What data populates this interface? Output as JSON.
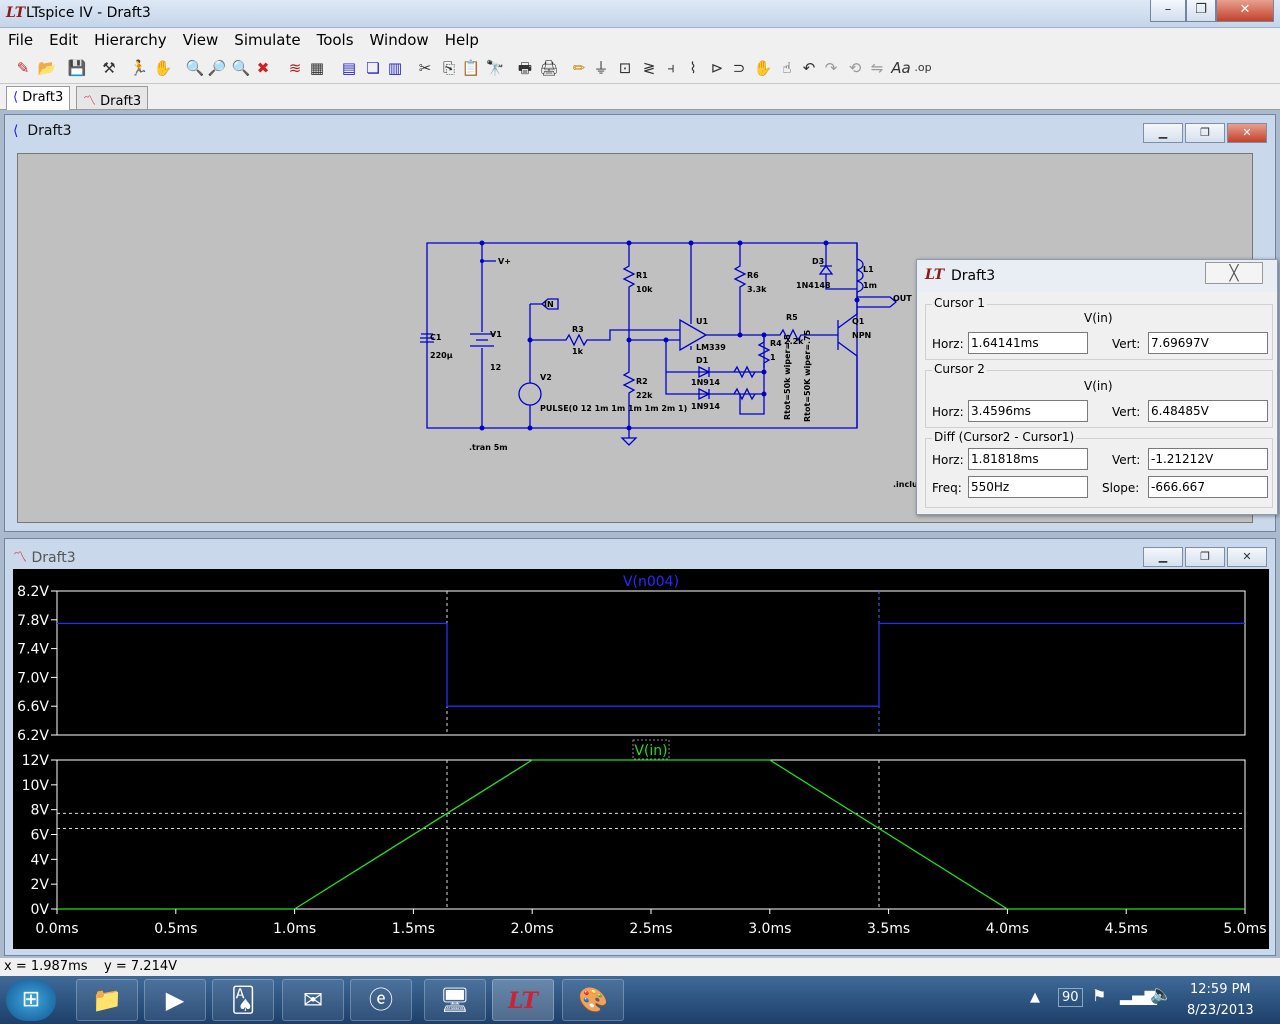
{
  "app": {
    "title": "LTspice IV - Draft3",
    "logo_text": "LT"
  },
  "menu": [
    "File",
    "Edit",
    "Hierarchy",
    "View",
    "Simulate",
    "Tools",
    "Window",
    "Help"
  ],
  "tabs": [
    {
      "label": "Draft3"
    },
    {
      "label": "Draft3"
    }
  ],
  "schematic_window": {
    "title": "Draft3",
    "labels": {
      "vplus": "V+",
      "in": "IN",
      "out": "OUT",
      "r1": "R1",
      "r1v": "10k",
      "r2": "R2",
      "r2v": "22k",
      "r3": "R3",
      "r3v": "1k",
      "r4": "R4",
      "r4v": "1",
      "r5": "R5",
      "r5v": "2.2k",
      "r6": "R6",
      "r6v": "3.3k",
      "u1": "U1",
      "u1v": "LM339",
      "c1": "C1",
      "c1v": "220µ",
      "v1": "V1",
      "v1v": "12",
      "v2": "V2",
      "v2v": "PULSE(0 12 1m 1m 1m 1m 2m 1)",
      "d1": "D1",
      "d1v": "1N914",
      "d2v": "1N914",
      "d3": "D3",
      "d3v": "1N4148",
      "l1": "L1",
      "l1v": "1m",
      "q1": "Q1",
      "q1v": "NPN",
      "pot1": "Rtot=50k wiper=.5",
      "pot2": "Rtot=50K wiper=.75",
      "tran": ".tran 5m",
      "include": ".include"
    }
  },
  "cursor_window": {
    "title": "Draft3",
    "cursor1": {
      "label": "Cursor 1",
      "trace": "V(in)",
      "horz_label": "Horz:",
      "horz": "1.64141ms",
      "vert_label": "Vert:",
      "vert": "7.69697V"
    },
    "cursor2": {
      "label": "Cursor 2",
      "trace": "V(in)",
      "horz_label": "Horz:",
      "horz": "3.4596ms",
      "vert_label": "Vert:",
      "vert": "6.48485V"
    },
    "diff": {
      "label": "Diff (Cursor2 - Cursor1)",
      "horz_label": "Horz:",
      "horz": "1.81818ms",
      "vert_label": "Vert:",
      "vert": "-1.21212V",
      "freq_label": "Freq:",
      "freq": "550Hz",
      "slope_label": "Slope:",
      "slope": "-666.667"
    }
  },
  "waveform_window": {
    "title": "Draft3"
  },
  "chart_data": [
    {
      "type": "line",
      "title": "V(n004)",
      "ylim": [
        6.2,
        8.2
      ],
      "yticks": [
        "8.2V",
        "7.8V",
        "7.4V",
        "7.0V",
        "6.6V",
        "6.2V"
      ],
      "ytick_values": [
        8.2,
        7.8,
        7.4,
        7.0,
        6.6,
        6.2
      ],
      "series": [
        {
          "name": "V(n004)",
          "color": "#2a2aff",
          "x": [
            0,
            1.64141,
            1.64141,
            3.4596,
            3.4596,
            5
          ],
          "y": [
            7.75,
            7.75,
            6.6,
            6.6,
            7.75,
            7.75
          ]
        }
      ],
      "cursors_x": [
        1.64141,
        3.4596
      ],
      "xlim": [
        0,
        5
      ]
    },
    {
      "type": "line",
      "title": "V(in)",
      "ylim": [
        0,
        12
      ],
      "yticks": [
        "12V",
        "10V",
        "8V",
        "6V",
        "4V",
        "2V",
        "0V"
      ],
      "ytick_values": [
        12,
        10,
        8,
        6,
        4,
        2,
        0
      ],
      "xticks": [
        "0.0ms",
        "0.5ms",
        "1.0ms",
        "1.5ms",
        "2.0ms",
        "2.5ms",
        "3.0ms",
        "3.5ms",
        "4.0ms",
        "4.5ms",
        "5.0ms"
      ],
      "xtick_values": [
        0,
        0.5,
        1,
        1.5,
        2,
        2.5,
        3,
        3.5,
        4,
        4.5,
        5
      ],
      "series": [
        {
          "name": "V(in)",
          "color": "#22dd22",
          "x": [
            0,
            1,
            2,
            3,
            4,
            5
          ],
          "y": [
            0,
            0,
            12,
            12,
            0,
            0
          ]
        }
      ],
      "cursors_x": [
        1.64141,
        3.4596
      ],
      "cursors_y": [
        7.69697,
        6.48485
      ],
      "xlim": [
        0,
        5
      ]
    }
  ],
  "status": {
    "x_text": "x = 1.987ms",
    "y_text": "y = 7.214V"
  },
  "tray": {
    "badge": "90",
    "time": "12:59 PM",
    "date": "8/23/2013"
  },
  "colors": {
    "wire": "#0000cc",
    "plot_bg": "#000000",
    "grid_line": "#ffffff"
  }
}
